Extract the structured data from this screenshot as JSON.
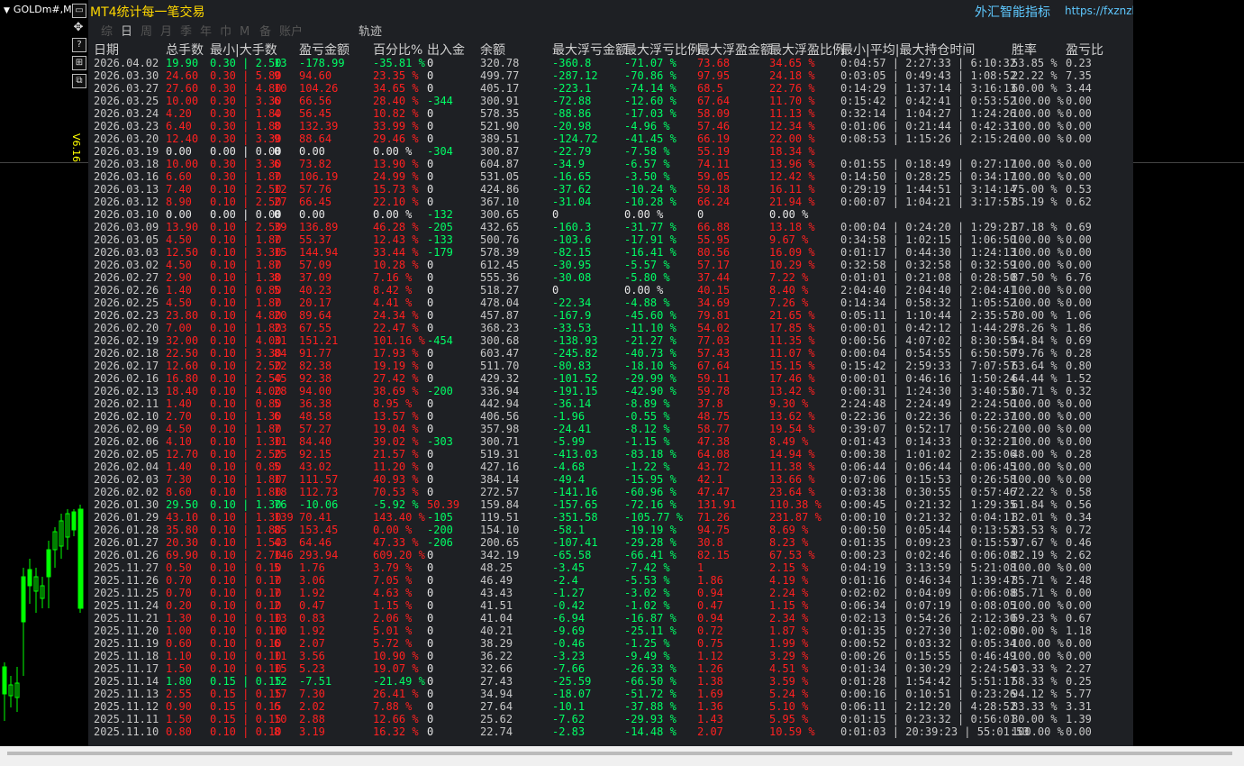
{
  "symbol": "GOLDm#,M",
  "panel_title": "MT4统计每一笔交易",
  "site_name": "外汇智能指标",
  "site_url": "https://fxznzb.com/",
  "version": "V6.16",
  "toolbar": [
    "综",
    "日",
    "周",
    "月",
    "季",
    "年",
    "巾",
    "M",
    "备",
    "账户"
  ],
  "toolbar_selected": 1,
  "track_label": "轨迹",
  "headers": [
    "日期",
    "总手数",
    "最小|大手数",
    "数",
    "盈亏金额",
    "百分比%",
    "出入金",
    "余额",
    "最大浮亏金额",
    "最大浮亏比例",
    "最大浮盈金额",
    "最大浮盈比例",
    "最小|平均|最大持仓时间",
    "胜率",
    "盈亏比"
  ],
  "rows": [
    [
      "2026.04.02",
      "19.90",
      "0.30 | 2.50",
      "13",
      "-178.99",
      "-35.81 %",
      "0",
      "320.78",
      "-360.8",
      "-71.07 %",
      "73.68",
      "34.65 %",
      "0:04:57 | 2:27:33 | 6:10:32",
      "53.85 %",
      "0.23",
      "g"
    ],
    [
      "2026.03.30",
      "24.60",
      "0.30 | 5.80",
      "9",
      "94.60",
      "23.35 %",
      "0",
      "499.77",
      "-287.12",
      "-70.86 %",
      "97.95",
      "24.18 %",
      "0:03:05 | 0:49:43 | 1:08:52",
      "22.22 %",
      "7.35",
      "r"
    ],
    [
      "2026.03.27",
      "27.60",
      "0.30 | 4.80",
      "10",
      "104.26",
      "34.65 %",
      "0",
      "405.17",
      "-223.1",
      "-74.14 %",
      "68.5",
      "22.76 %",
      "0:14:29 | 1:37:14 | 3:16:13",
      "60.00 %",
      "3.44",
      "r"
    ],
    [
      "2026.03.25",
      "10.00",
      "0.30 | 3.30",
      "6",
      "66.56",
      "28.40 %",
      "-344",
      "300.91",
      "-72.88",
      "-12.60 %",
      "67.64",
      "11.70 %",
      "0:15:42 | 0:42:41 | 0:53:52",
      "100.00 %",
      "0.00",
      "r"
    ],
    [
      "2026.03.24",
      "4.20",
      "0.30 | 1.80",
      "4",
      "56.45",
      "10.82 %",
      "0",
      "578.35",
      "-88.86",
      "-17.03 %",
      "58.09",
      "11.13 %",
      "0:32:14 | 1:04:27 | 1:24:26",
      "100.00 %",
      "0.00",
      "r"
    ],
    [
      "2026.03.23",
      "6.40",
      "0.30 | 1.80",
      "8",
      "132.39",
      "33.99 %",
      "0",
      "521.90",
      "-20.98",
      "-4.96 %",
      "57.46",
      "12.34 %",
      "0:01:06 | 0:21:44 | 0:42:33",
      "100.00 %",
      "0.00",
      "r"
    ],
    [
      "2026.03.20",
      "12.40",
      "0.30 | 3.30",
      "9",
      "88.64",
      "29.46 %",
      "0",
      "389.51",
      "-124.72",
      "-41.45 %",
      "66.19",
      "22.00 %",
      "0:08:53 | 1:15:26 | 2:15:26",
      "100.00 %",
      "0.00",
      "r"
    ],
    [
      "2026.03.19",
      "0.00",
      "0.00 | 0.00",
      "0",
      "0.00",
      "0.00 %",
      "-304",
      "300.87",
      "-22.79",
      "-7.58 %",
      "55.19",
      "18.34 %",
      "",
      "",
      "",
      "w"
    ],
    [
      "2026.03.18",
      "10.00",
      "0.30 | 3.30",
      "6",
      "73.82",
      "13.90 %",
      "0",
      "604.87",
      "-34.9",
      "-6.57 %",
      "74.11",
      "13.96 %",
      "0:01:55 | 0:18:49 | 0:27:17",
      "100.00 %",
      "0.00",
      "r"
    ],
    [
      "2026.03.16",
      "6.60",
      "0.30 | 1.80",
      "7",
      "106.19",
      "24.99 %",
      "0",
      "531.05",
      "-16.65",
      "-3.50 %",
      "59.05",
      "12.42 %",
      "0:14:50 | 0:28:25 | 0:34:17",
      "100.00 %",
      "0.00",
      "r"
    ],
    [
      "2026.03.13",
      "7.40",
      "0.10 | 2.50",
      "12",
      "57.76",
      "15.73 %",
      "0",
      "424.86",
      "-37.62",
      "-10.24 %",
      "59.18",
      "16.11 %",
      "0:29:19 | 1:44:51 | 3:14:14",
      "75.00 %",
      "0.53",
      "r"
    ],
    [
      "2026.03.12",
      "8.90",
      "0.10 | 2.50",
      "27",
      "66.45",
      "22.10 %",
      "0",
      "367.10",
      "-31.04",
      "-10.28 %",
      "66.24",
      "21.94 %",
      "0:00:07 | 1:04:21 | 3:17:57",
      "85.19 %",
      "0.62",
      "r"
    ],
    [
      "2026.03.10",
      "0.00",
      "0.00 | 0.00",
      "0",
      "0.00",
      "0.00 %",
      "-132",
      "300.65",
      "0",
      "0.00 %",
      "0",
      "0.00 %",
      "",
      "",
      "",
      "w"
    ],
    [
      "2026.03.09",
      "13.90",
      "0.10 | 2.50",
      "39",
      "136.89",
      "46.28 %",
      "-205",
      "432.65",
      "-160.3",
      "-31.77 %",
      "66.88",
      "13.18 %",
      "0:00:04 | 0:24:20 | 1:29:21",
      "87.18 %",
      "0.69",
      "r"
    ],
    [
      "2026.03.05",
      "4.50",
      "0.10 | 1.80",
      "7",
      "55.37",
      "12.43 %",
      "-133",
      "500.76",
      "-103.6",
      "-17.91 %",
      "55.95",
      "9.67 %",
      "0:34:58 | 1:02:15 | 1:06:50",
      "100.00 %",
      "0.00",
      "r"
    ],
    [
      "2026.03.03",
      "12.50",
      "0.10 | 3.30",
      "15",
      "144.94",
      "33.44 %",
      "-179",
      "578.39",
      "-82.15",
      "-16.41 %",
      "80.56",
      "16.09 %",
      "0:01:17 | 0:44:30 | 1:24:13",
      "100.00 %",
      "0.00",
      "r"
    ],
    [
      "2026.03.02",
      "4.50",
      "0.10 | 1.80",
      "7",
      "57.09",
      "10.28 %",
      "0",
      "612.45",
      "-30.95",
      "-5.57 %",
      "57.17",
      "10.29 %",
      "0:32:58 | 0:32:58 | 0:32:59",
      "100.00 %",
      "0.00",
      "r"
    ],
    [
      "2026.02.27",
      "2.90",
      "0.10 | 1.30",
      "8",
      "37.09",
      "7.16 %",
      "0",
      "555.36",
      "-30.08",
      "-5.80 %",
      "37.44",
      "7.22 %",
      "0:01:01 | 0:21:08 | 0:28:50",
      "87.50 %",
      "6.76",
      "r"
    ],
    [
      "2026.02.26",
      "1.40",
      "0.10 | 0.80",
      "5",
      "40.23",
      "8.42 %",
      "0",
      "518.27",
      "0",
      "0.00 %",
      "40.15",
      "8.40 %",
      "2:04:40 | 2:04:40 | 2:04:41",
      "100.00 %",
      "0.00",
      "r"
    ],
    [
      "2026.02.25",
      "4.50",
      "0.10 | 1.80",
      "7",
      "20.17",
      "4.41 %",
      "0",
      "478.04",
      "-22.34",
      "-4.88 %",
      "34.69",
      "7.26 %",
      "0:14:34 | 0:58:32 | 1:05:52",
      "100.00 %",
      "0.00",
      "r"
    ],
    [
      "2026.02.23",
      "23.80",
      "0.10 | 4.80",
      "20",
      "89.64",
      "24.34 %",
      "0",
      "457.87",
      "-167.9",
      "-45.60 %",
      "79.81",
      "21.65 %",
      "0:05:11 | 1:10:44 | 2:35:57",
      "30.00 %",
      "1.06",
      "r"
    ],
    [
      "2026.02.20",
      "7.00",
      "0.10 | 1.80",
      "23",
      "67.55",
      "22.47 %",
      "0",
      "368.23",
      "-33.53",
      "-11.10 %",
      "54.02",
      "17.85 %",
      "0:00:01 | 0:42:12 | 1:44:28",
      "78.26 %",
      "1.86",
      "r"
    ],
    [
      "2026.02.19",
      "32.00",
      "0.10 | 4.00",
      "31",
      "151.21",
      "101.16 %",
      "-454",
      "300.68",
      "-138.93",
      "-21.27 %",
      "77.03",
      "11.35 %",
      "0:00:56 | 4:07:02 | 8:30:59",
      "54.84 %",
      "0.69",
      "r"
    ],
    [
      "2026.02.18",
      "22.50",
      "0.10 | 3.30",
      "84",
      "91.77",
      "17.93 %",
      "0",
      "603.47",
      "-245.82",
      "-40.73 %",
      "57.43",
      "11.07 %",
      "0:00:04 | 0:54:55 | 6:50:50",
      "79.76 %",
      "0.28",
      "r"
    ],
    [
      "2026.02.17",
      "12.60",
      "0.10 | 2.50",
      "22",
      "82.38",
      "19.19 %",
      "0",
      "511.70",
      "-80.83",
      "-18.10 %",
      "67.64",
      "15.15 %",
      "0:15:42 | 2:59:33 | 7:07:57",
      "63.64 %",
      "0.80",
      "r"
    ],
    [
      "2026.02.16",
      "16.80",
      "0.10 | 2.50",
      "45",
      "92.38",
      "27.42 %",
      "0",
      "429.32",
      "-101.52",
      "-29.99 %",
      "59.11",
      "17.46 %",
      "0:00:01 | 0:46:16 | 1:50:24",
      "64.44 %",
      "1.52",
      "r"
    ],
    [
      "2026.02.13",
      "18.40",
      "0.10 | 4.00",
      "28",
      "94.00",
      "38.69 %",
      "-200",
      "336.94",
      "-191.15",
      "-42.90 %",
      "59.78",
      "13.42 %",
      "0:00:31 | 1:24:30 | 3:40:53",
      "60.71 %",
      "0.32",
      "r"
    ],
    [
      "2026.02.11",
      "1.40",
      "0.10 | 0.80",
      "5",
      "36.38",
      "8.95 %",
      "0",
      "442.94",
      "-36.14",
      "-8.89 %",
      "37.8",
      "9.30 %",
      "2:24:48 | 2:24:49 | 2:24:50",
      "100.00 %",
      "0.00",
      "r"
    ],
    [
      "2026.02.10",
      "2.70",
      "0.10 | 1.30",
      "6",
      "48.58",
      "13.57 %",
      "0",
      "406.56",
      "-1.96",
      "-0.55 %",
      "48.75",
      "13.62 %",
      "0:22:36 | 0:22:36 | 0:22:37",
      "100.00 %",
      "0.00",
      "r"
    ],
    [
      "2026.02.09",
      "4.50",
      "0.10 | 1.80",
      "7",
      "57.27",
      "19.04 %",
      "0",
      "357.98",
      "-24.41",
      "-8.12 %",
      "58.77",
      "19.54 %",
      "0:39:07 | 0:52:17 | 0:56:27",
      "100.00 %",
      "0.00",
      "r"
    ],
    [
      "2026.02.06",
      "4.10",
      "0.10 | 1.30",
      "11",
      "84.40",
      "39.02 %",
      "-303",
      "300.71",
      "-5.99",
      "-1.15 %",
      "47.38",
      "8.49 %",
      "0:01:43 | 0:14:33 | 0:32:21",
      "100.00 %",
      "0.00",
      "r"
    ],
    [
      "2026.02.05",
      "12.70",
      "0.10 | 2.50",
      "25",
      "92.15",
      "21.57 %",
      "0",
      "519.31",
      "-413.03",
      "-83.18 %",
      "64.08",
      "14.94 %",
      "0:00:38 | 1:01:02 | 2:35:06",
      "48.00 %",
      "0.28",
      "r"
    ],
    [
      "2026.02.04",
      "1.40",
      "0.10 | 0.80",
      "5",
      "43.02",
      "11.20 %",
      "0",
      "427.16",
      "-4.68",
      "-1.22 %",
      "43.72",
      "11.38 %",
      "0:06:44 | 0:06:44 | 0:06:45",
      "100.00 %",
      "0.00",
      "r"
    ],
    [
      "2026.02.03",
      "7.30",
      "0.10 | 1.80",
      "17",
      "111.57",
      "40.93 %",
      "0",
      "384.14",
      "-49.4",
      "-15.95 %",
      "42.1",
      "13.66 %",
      "0:07:06 | 0:15:53 | 0:26:58",
      "100.00 %",
      "0.00",
      "r"
    ],
    [
      "2026.02.02",
      "8.60",
      "0.10 | 1.80",
      "18",
      "112.73",
      "70.53 %",
      "0",
      "272.57",
      "-141.16",
      "-60.96 %",
      "47.47",
      "23.64 %",
      "0:03:38 | 0:30:55 | 0:57:46",
      "72.22 %",
      "0.58",
      "r"
    ],
    [
      "2026.01.30",
      "29.50",
      "0.10 | 1.30",
      "76",
      "-10.06",
      "-5.92 %",
      "50.39",
      "159.84",
      "-157.65",
      "-72.16 %",
      "131.91",
      "110.38 %",
      "0:00:45 | 0:21:32 | 1:29:35",
      "61.84 %",
      "0.56",
      "g"
    ],
    [
      "2026.01.29",
      "43.10",
      "0.10 | 1.30",
      "139",
      "70.41",
      "143.40 %",
      "-105",
      "119.51",
      "-351.58",
      "-105.77 %",
      "71.26",
      "231.87 %",
      "0:00:10 | 0:21:32 | 0:04:11",
      "82.01 %",
      "0.34",
      "r"
    ],
    [
      "2026.01.28",
      "35.80",
      "0.10 | 1.80",
      "85",
      "153.45",
      "0.00 %",
      "-200",
      "154.10",
      "-58.1",
      "-19.19 %",
      "94.75",
      "8.69 %",
      "0:00:50 | 0:05:44 | 0:13:52",
      "83.53 %",
      "0.72",
      "r"
    ],
    [
      "2026.01.27",
      "20.30",
      "0.10 | 1.50",
      "43",
      "64.46",
      "47.33 %",
      "-206",
      "200.65",
      "-107.41",
      "-29.28 %",
      "30.8",
      "8.23 %",
      "0:01:35 | 0:09:23 | 0:15:53",
      "97.67 %",
      "0.46",
      "r"
    ],
    [
      "2026.01.26",
      "69.90",
      "0.10 | 2.70",
      "146",
      "293.94",
      "609.20 %",
      "0",
      "342.19",
      "-65.58",
      "-66.41 %",
      "82.15",
      "67.53 %",
      "0:00:23 | 0:02:46 | 0:06:08",
      "82.19 %",
      "2.62",
      "r"
    ],
    [
      "2025.11.27",
      "0.50",
      "0.10 | 0.10",
      "5",
      "1.76",
      "3.79 %",
      "0",
      "48.25",
      "-3.45",
      "-7.42 %",
      "1",
      "2.15 %",
      "0:04:19 | 3:13:59 | 5:21:08",
      "100.00 %",
      "0.00",
      "r"
    ],
    [
      "2025.11.26",
      "0.70",
      "0.10 | 0.10",
      "7",
      "3.06",
      "7.05 %",
      "0",
      "46.49",
      "-2.4",
      "-5.53 %",
      "1.86",
      "4.19 %",
      "0:01:16 | 0:46:34 | 1:39:47",
      "85.71 %",
      "2.48",
      "r"
    ],
    [
      "2025.11.25",
      "0.70",
      "0.10 | 0.10",
      "7",
      "1.92",
      "4.63 %",
      "0",
      "43.43",
      "-1.27",
      "-3.02 %",
      "0.94",
      "2.24 %",
      "0:02:02 | 0:04:09 | 0:06:08",
      "85.71 %",
      "0.00",
      "r"
    ],
    [
      "2025.11.24",
      "0.20",
      "0.10 | 0.10",
      "2",
      "0.47",
      "1.15 %",
      "0",
      "41.51",
      "-0.42",
      "-1.02 %",
      "0.47",
      "1.15 %",
      "0:06:34 | 0:07:19 | 0:08:05",
      "100.00 %",
      "0.00",
      "r"
    ],
    [
      "2025.11.21",
      "1.30",
      "0.10 | 0.10",
      "13",
      "0.83",
      "2.06 %",
      "0",
      "41.04",
      "-6.94",
      "-16.87 %",
      "0.94",
      "2.34 %",
      "0:02:13 | 0:54:26 | 2:12:30",
      "69.23 %",
      "0.67",
      "r"
    ],
    [
      "2025.11.20",
      "1.00",
      "0.10 | 0.10",
      "10",
      "1.92",
      "5.01 %",
      "0",
      "40.21",
      "-9.69",
      "-25.11 %",
      "0.72",
      "1.87 %",
      "0:01:35 | 0:27:30 | 1:02:08",
      "90.00 %",
      "1.18",
      "r"
    ],
    [
      "2025.11.19",
      "0.60",
      "0.10 | 0.10",
      "6",
      "2.07",
      "5.72 %",
      "0",
      "38.29",
      "-0.46",
      "-1.25 %",
      "0.75",
      "1.99 %",
      "0:00:52 | 0:03:32 | 0:05:34",
      "100.00 %",
      "0.00",
      "r"
    ],
    [
      "2025.11.18",
      "1.10",
      "0.10 | 0.10",
      "11",
      "3.56",
      "10.90 %",
      "0",
      "36.22",
      "-3.23",
      "-9.49 %",
      "1.12",
      "3.29 %",
      "0:00:26 | 0:15:55 | 0:46:49",
      "100.00 %",
      "0.00",
      "r"
    ],
    [
      "2025.11.17",
      "1.50",
      "0.10 | 0.10",
      "15",
      "5.23",
      "19.07 %",
      "0",
      "32.66",
      "-7.66",
      "-26.33 %",
      "1.26",
      "4.51 %",
      "0:01:34 | 0:30:29 | 2:24:54",
      "93.33 %",
      "2.27",
      "r"
    ],
    [
      "2025.11.14",
      "1.80",
      "0.15 | 0.15",
      "12",
      "-7.51",
      "-21.49 %",
      "0",
      "27.43",
      "-25.59",
      "-66.50 %",
      "1.38",
      "3.59 %",
      "0:01:28 | 1:54:42 | 5:51:17",
      "58.33 %",
      "0.25",
      "g"
    ],
    [
      "2025.11.13",
      "2.55",
      "0.15 | 0.15",
      "17",
      "7.30",
      "26.41 %",
      "0",
      "34.94",
      "-18.07",
      "-51.72 %",
      "1.69",
      "5.24 %",
      "0:00:16 | 0:10:51 | 0:23:26",
      "94.12 %",
      "5.77",
      "r"
    ],
    [
      "2025.11.12",
      "0.90",
      "0.15 | 0.15",
      "6",
      "2.02",
      "7.88 %",
      "0",
      "27.64",
      "-10.1",
      "-37.88 %",
      "1.36",
      "5.10 %",
      "0:06:11 | 2:12:20 | 4:28:52",
      "83.33 %",
      "3.31",
      "r"
    ],
    [
      "2025.11.11",
      "1.50",
      "0.15 | 0.15",
      "10",
      "2.88",
      "12.66 %",
      "0",
      "25.62",
      "-7.62",
      "-29.93 %",
      "1.43",
      "5.95 %",
      "0:01:15 | 0:23:32 | 0:56:01",
      "80.00 %",
      "1.39",
      "r"
    ],
    [
      "2025.11.10",
      "0.80",
      "0.10 | 0.10",
      "8",
      "3.19",
      "16.32 %",
      "0",
      "22.74",
      "-2.83",
      "-14.48 %",
      "2.07",
      "10.59 %",
      "0:01:03 | 20:39:23 | 55:01:53",
      "100.00 %",
      "0.00",
      "r"
    ]
  ],
  "colors": {
    "profit": "#ff2020",
    "loss": "#00ff66",
    "neutral": "#e6e6e6",
    "title": "#ffd700",
    "link": "#5ec8ff"
  }
}
